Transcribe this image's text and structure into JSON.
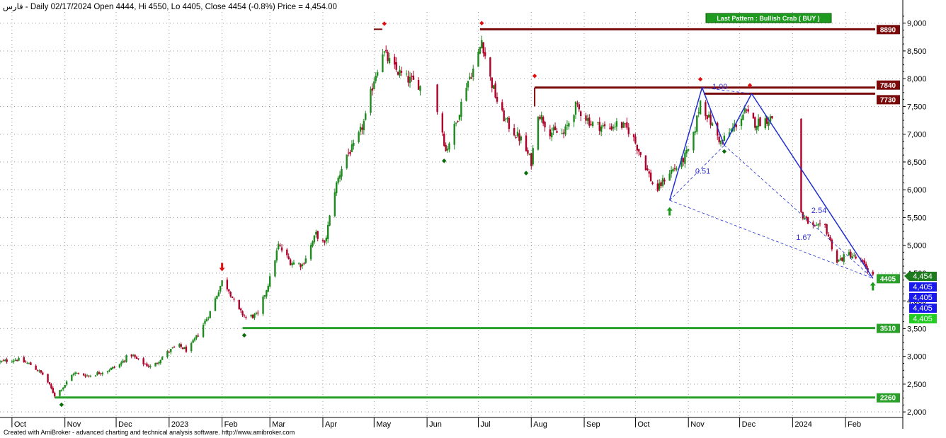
{
  "header": {
    "text": "فارس - Daily 02/17/2024 Open 4444, Hi 4550, Lo 4405, Close 4454 (-0.8%) Price = 4,454.00"
  },
  "footer": {
    "text": "Created with AmiBroker - advanced charting and technical analysis software. http://www.amibroker.com"
  },
  "chart_data": {
    "type": "candlestick",
    "symbol": "فارس",
    "timeframe": "Daily",
    "last_bar": {
      "date": "02/17/2024",
      "open": 4444,
      "high": 4550,
      "low": 4405,
      "close": 4454,
      "change_pct": -0.8
    },
    "x_range": [
      "2022-09-24",
      "2024-02-20"
    ],
    "ylim": [
      1900,
      9200
    ],
    "y_ticks": [
      2000,
      2500,
      3000,
      3500,
      4000,
      4500,
      5000,
      5500,
      6000,
      6500,
      7000,
      7500,
      8000,
      8500,
      9000
    ],
    "y_tick_labels": [
      "2,000",
      "2,500",
      "3,000",
      "3,500",
      "4,000",
      "4,500",
      "5,000",
      "5,500",
      "6,000",
      "6,500",
      "7,000",
      "7,500",
      "8,000",
      "8,500",
      "9,000"
    ],
    "x_ticks": [
      {
        "label": "Oct",
        "date": "2022-10-01"
      },
      {
        "label": "Nov",
        "date": "2022-11-01"
      },
      {
        "label": "Dec",
        "date": "2022-12-01"
      },
      {
        "label": "2023",
        "date": "2023-01-01"
      },
      {
        "label": "Feb",
        "date": "2023-02-01"
      },
      {
        "label": "Mar",
        "date": "2023-03-01"
      },
      {
        "label": "Apr",
        "date": "2023-04-01"
      },
      {
        "label": "May",
        "date": "2023-05-01"
      },
      {
        "label": "Jun",
        "date": "2023-06-01"
      },
      {
        "label": "Jul",
        "date": "2023-07-01"
      },
      {
        "label": "Aug",
        "date": "2023-08-01"
      },
      {
        "label": "Sep",
        "date": "2023-09-01"
      },
      {
        "label": "Oct",
        "date": "2023-10-01"
      },
      {
        "label": "Nov",
        "date": "2023-11-01"
      },
      {
        "label": "Dec",
        "date": "2023-12-01"
      },
      {
        "label": "2024",
        "date": "2024-01-01"
      },
      {
        "label": "Feb",
        "date": "2024-02-01"
      }
    ],
    "price_path": [
      [
        "2022-09-24",
        2900
      ],
      [
        "2022-10-04",
        2950
      ],
      [
        "2022-10-12",
        2850
      ],
      [
        "2022-10-20",
        2650
      ],
      [
        "2022-10-26",
        2300
      ],
      [
        "2022-10-31",
        2450
      ],
      [
        "2022-11-06",
        2700
      ],
      [
        "2022-11-15",
        2650
      ],
      [
        "2022-11-26",
        2750
      ],
      [
        "2022-12-03",
        2850
      ],
      [
        "2022-12-09",
        3050
      ],
      [
        "2022-12-15",
        2900
      ],
      [
        "2022-12-22",
        2800
      ],
      [
        "2022-12-30",
        3050
      ],
      [
        "2023-01-06",
        3200
      ],
      [
        "2023-01-12",
        3100
      ],
      [
        "2023-01-18",
        3400
      ],
      [
        "2023-01-25",
        3800
      ],
      [
        "2023-02-01",
        4350
      ],
      [
        "2023-02-05",
        4200
      ],
      [
        "2023-02-10",
        3850
      ],
      [
        "2023-02-15",
        3700
      ],
      [
        "2023-02-22",
        3750
      ],
      [
        "2023-03-01",
        4400
      ],
      [
        "2023-03-06",
        5000
      ],
      [
        "2023-03-13",
        4700
      ],
      [
        "2023-03-20",
        4650
      ],
      [
        "2023-03-28",
        5200
      ],
      [
        "2023-04-02",
        5000
      ],
      [
        "2023-04-08",
        6000
      ],
      [
        "2023-04-14",
        6600
      ],
      [
        "2023-04-20",
        6800
      ],
      [
        "2023-04-26",
        7300
      ],
      [
        "2023-05-01",
        8000
      ],
      [
        "2023-05-06",
        8500
      ],
      [
        "2023-05-12",
        8200
      ],
      [
        "2023-05-20",
        8000
      ],
      [
        "2023-05-27",
        7900
      ],
      [
        "2023-06-08",
        7400
      ],
      [
        "2023-06-12",
        6700
      ],
      [
        "2023-06-18",
        7200
      ],
      [
        "2023-06-24",
        7900
      ],
      [
        "2023-06-30",
        8300
      ],
      [
        "2023-07-03",
        8700
      ],
      [
        "2023-07-08",
        8000
      ],
      [
        "2023-07-14",
        7400
      ],
      [
        "2023-07-20",
        7100
      ],
      [
        "2023-07-26",
        6900
      ],
      [
        "2023-08-01",
        6500
      ],
      [
        "2023-08-05",
        7400
      ],
      [
        "2023-08-12",
        7050
      ],
      [
        "2023-08-20",
        7000
      ],
      [
        "2023-08-27",
        7500
      ],
      [
        "2023-09-05",
        7200
      ],
      [
        "2023-09-15",
        7100
      ],
      [
        "2023-09-21",
        7200
      ],
      [
        "2023-09-28",
        7050
      ],
      [
        "2023-10-06",
        6500
      ],
      [
        "2023-10-13",
        5950
      ],
      [
        "2023-10-20",
        6300
      ],
      [
        "2023-10-27",
        6450
      ],
      [
        "2023-11-03",
        6800
      ],
      [
        "2023-11-08",
        7600
      ],
      [
        "2023-11-15",
        7150
      ],
      [
        "2023-11-20",
        6850
      ],
      [
        "2023-11-27",
        7100
      ],
      [
        "2023-12-04",
        7400
      ],
      [
        "2023-12-10",
        7200
      ],
      [
        "2023-12-20",
        7300
      ],
      [
        "2024-01-07",
        5500
      ],
      [
        "2024-01-14",
        5300
      ],
      [
        "2024-01-20",
        5350
      ],
      [
        "2024-01-27",
        4700
      ],
      [
        "2024-02-03",
        4850
      ],
      [
        "2024-02-10",
        4700
      ],
      [
        "2024-02-17",
        4454
      ]
    ],
    "resistance_levels": [
      {
        "label": "8890",
        "value": 8890
      },
      {
        "label": "7840",
        "value": 7840
      },
      {
        "label": "7730",
        "value": 7730
      }
    ],
    "support_levels": [
      {
        "label": "3510",
        "value": 3510
      },
      {
        "label": "2260",
        "value": 2260
      }
    ],
    "pattern": {
      "label": "Last Pattern : Bullish Crab ( BUY )",
      "points": [
        {
          "name": "X",
          "date": "2023-10-21",
          "value": 5810
        },
        {
          "name": "A",
          "date": "2023-11-09",
          "value": 7840
        },
        {
          "name": "B",
          "date": "2023-11-22",
          "value": 6800
        },
        {
          "name": "C",
          "date": "2023-12-08",
          "value": 7730
        },
        {
          "name": "D",
          "date": "2024-02-17",
          "value": 4405
        }
      ],
      "ratios": [
        {
          "text": "0.51",
          "date": "2023-11-05",
          "value": 6340
        },
        {
          "text": "1.00",
          "date": "2023-11-15",
          "value": 7860
        },
        {
          "text": "2.54",
          "date": "2024-01-12",
          "value": 5630
        },
        {
          "text": "1.67",
          "date": "2024-01-03",
          "value": 5150
        }
      ]
    },
    "markers": {
      "green_diamonds": [
        {
          "date": "2022-10-30",
          "value": 2130
        },
        {
          "date": "2023-02-14",
          "value": 3380
        },
        {
          "date": "2023-06-11",
          "value": 6520
        },
        {
          "date": "2023-07-29",
          "value": 6300
        },
        {
          "date": "2023-11-22",
          "value": 6690
        }
      ],
      "red_diamonds": [
        {
          "date": "2023-05-07",
          "value": 8990
        },
        {
          "date": "2023-07-03",
          "value": 9000
        },
        {
          "date": "2023-08-03",
          "value": 8050
        },
        {
          "date": "2023-11-08",
          "value": 7990
        },
        {
          "date": "2023-12-07",
          "value": 7880
        }
      ],
      "green_arrows": [
        {
          "date": "2023-10-21",
          "value": 5600
        },
        {
          "date": "2024-02-17",
          "value": 4250
        }
      ],
      "red_arrows": [
        {
          "date": "2023-02-01",
          "value": 4620
        }
      ]
    },
    "price_labels": [
      {
        "text": "4,454",
        "color": "#1d7a1d"
      },
      {
        "text": "4,405",
        "color": "#1a1aee"
      },
      {
        "text": "4,405",
        "color": "#1a1aee"
      },
      {
        "text": "4,405",
        "color": "#1a1aee"
      },
      {
        "text": "4,405",
        "color": "#22cc22"
      }
    ],
    "colors": {
      "up": "#1e8a1e",
      "down": "#b0002a",
      "resistance": "#7a0a0a",
      "support": "#2aa02a",
      "pattern": "#1f2fd0",
      "grid": "#999999"
    },
    "grid": true
  }
}
